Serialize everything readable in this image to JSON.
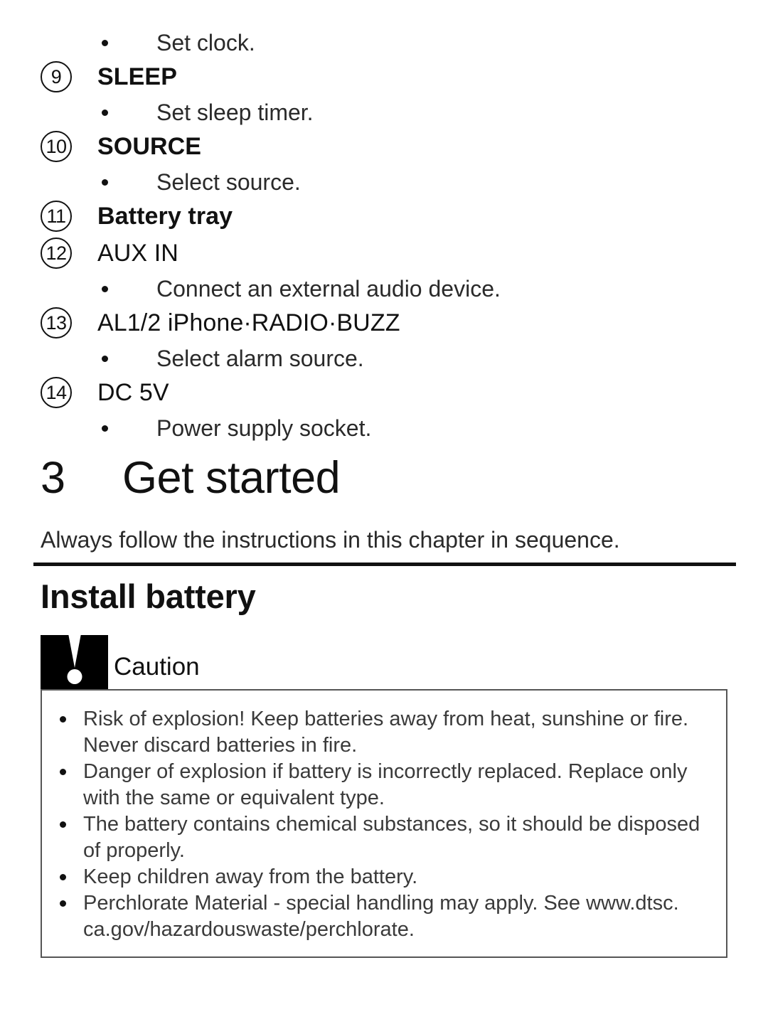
{
  "document": {
    "type": "user-manual-page",
    "language": "en"
  },
  "feature_list": {
    "leading_bullet": {
      "marker": "•",
      "text": "Set clock."
    },
    "items": [
      {
        "number": "9",
        "label": "SLEEP",
        "label_style": "uppercase",
        "bullets": [
          {
            "marker": "•",
            "text": "Set sleep timer."
          }
        ]
      },
      {
        "number": "10",
        "label": "SOURCE",
        "label_style": "uppercase",
        "bullets": [
          {
            "marker": "•",
            "text": "Select source."
          }
        ]
      },
      {
        "number": "11",
        "label": "Battery tray",
        "label_style": "sentence",
        "bullets": []
      },
      {
        "number": "12",
        "label": "AUX IN",
        "label_style": "uppercase-light",
        "bullets": [
          {
            "marker": "•",
            "text": "Connect an external audio device."
          }
        ]
      },
      {
        "number": "13",
        "label": "AL1/2 iPhone·RADIO·BUZZ",
        "label_style": "mixed-light",
        "bullets": [
          {
            "marker": "•",
            "text": "Select alarm source."
          }
        ]
      },
      {
        "number": "14",
        "label": "DC 5V",
        "label_style": "uppercase-light",
        "bullets": [
          {
            "marker": "•",
            "text": "Power supply socket."
          }
        ]
      }
    ]
  },
  "chapter": {
    "number": "3",
    "title": "Get started",
    "intro": "Always follow the instructions in this chapter in sequence."
  },
  "section": {
    "title": "Install battery"
  },
  "caution": {
    "icon_name": "exclamation-mark-icon",
    "label": "Caution",
    "items": [
      "Risk of explosion! Keep batteries away from heat, sunshine or fire. Never discard batteries in fire.",
      "Danger of explosion if battery is incorrectly replaced. Replace only with the same or equivalent type.",
      "The battery contains chemical substances, so it should be disposed of properly.",
      "Keep children away from the battery.",
      "Perchlorate Material - special handling may apply. See www.dtsc. ca.gov/hazardouswaste/perchlorate."
    ]
  },
  "colors": {
    "text": "#1a1a1a",
    "body_text": "#2a2a2a",
    "caution_text": "#3a3a3a",
    "rule": "#111111",
    "box_border": "#555555",
    "icon_background": "#000000",
    "page_background": "#ffffff"
  }
}
